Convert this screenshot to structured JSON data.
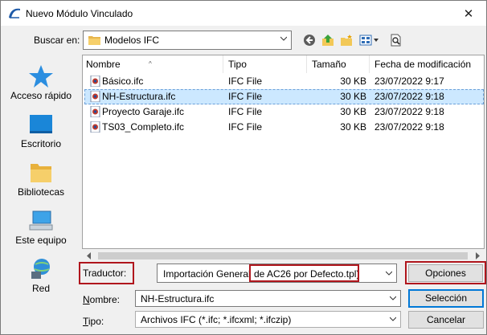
{
  "window": {
    "title": "Nuevo Módulo Vinculado",
    "close_glyph": "✕"
  },
  "lookin": {
    "label": "Buscar en:",
    "value": "Modelos IFC"
  },
  "toolbar": {
    "back": "back-icon",
    "up": "up-folder-icon",
    "new_folder": "new-folder-icon",
    "views": "views-menu-icon",
    "preview": "preview-icon"
  },
  "places": [
    {
      "label": "Acceso rápido",
      "icon": "star-icon"
    },
    {
      "label": "Escritorio",
      "icon": "desktop-icon"
    },
    {
      "label": "Bibliotecas",
      "icon": "libraries-icon"
    },
    {
      "label": "Este equipo",
      "icon": "computer-icon"
    },
    {
      "label": "Red",
      "icon": "network-icon"
    }
  ],
  "columns": {
    "name": "Nombre",
    "type": "Tipo",
    "size": "Tamaño",
    "date": "Fecha de modificación"
  },
  "files": [
    {
      "name": "Básico.ifc",
      "type": "IFC File",
      "size": "30 KB",
      "date": "23/07/2022 9:17",
      "selected": false
    },
    {
      "name": "NH-Estructura.ifc",
      "type": "IFC File",
      "size": "30 KB",
      "date": "23/07/2022 9:18",
      "selected": true
    },
    {
      "name": "Proyecto Garaje.ifc",
      "type": "IFC File",
      "size": "30 KB",
      "date": "23/07/2022 9:18",
      "selected": false
    },
    {
      "name": "TS03_Completo.ifc",
      "type": "IFC File",
      "size": "30 KB",
      "date": "23/07/2022 9:18",
      "selected": false
    }
  ],
  "translator": {
    "label": "Traductor:",
    "value_part1": "Importación General",
    "value_part2": "de AC26 por Defecto.tpl)",
    "options_button": "Opciones"
  },
  "filename": {
    "label": "Nombre:",
    "value": "NH-Estructura.ifc",
    "select_button": "Selección"
  },
  "filetype": {
    "label": "Tipo:",
    "value": "Archivos IFC (*.ifc; *.ifcxml; *.ifczip)",
    "cancel_button": "Cancelar"
  },
  "colors": {
    "highlight": "#b0161d",
    "selection": "#cce8ff",
    "accent": "#0078d7"
  }
}
